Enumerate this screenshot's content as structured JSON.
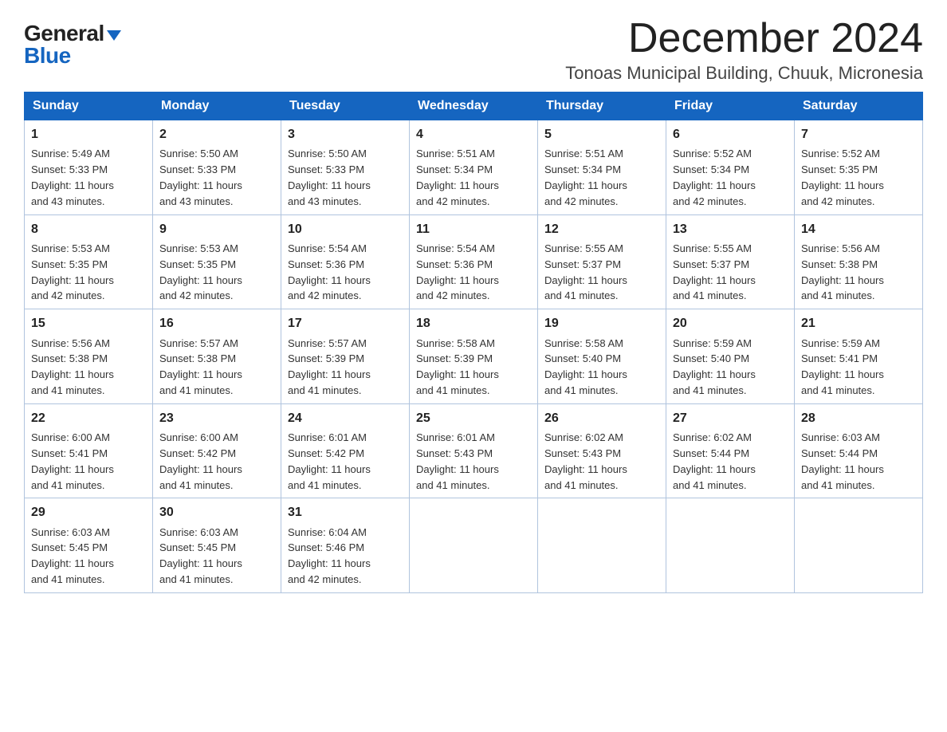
{
  "header": {
    "logo_general": "General",
    "logo_blue": "Blue",
    "month_title": "December 2024",
    "location": "Tonoas Municipal Building, Chuuk, Micronesia"
  },
  "weekdays": [
    "Sunday",
    "Monday",
    "Tuesday",
    "Wednesday",
    "Thursday",
    "Friday",
    "Saturday"
  ],
  "weeks": [
    [
      {
        "day": "1",
        "sunrise": "5:49 AM",
        "sunset": "5:33 PM",
        "daylight": "11 hours and 43 minutes."
      },
      {
        "day": "2",
        "sunrise": "5:50 AM",
        "sunset": "5:33 PM",
        "daylight": "11 hours and 43 minutes."
      },
      {
        "day": "3",
        "sunrise": "5:50 AM",
        "sunset": "5:33 PM",
        "daylight": "11 hours and 43 minutes."
      },
      {
        "day": "4",
        "sunrise": "5:51 AM",
        "sunset": "5:34 PM",
        "daylight": "11 hours and 42 minutes."
      },
      {
        "day": "5",
        "sunrise": "5:51 AM",
        "sunset": "5:34 PM",
        "daylight": "11 hours and 42 minutes."
      },
      {
        "day": "6",
        "sunrise": "5:52 AM",
        "sunset": "5:34 PM",
        "daylight": "11 hours and 42 minutes."
      },
      {
        "day": "7",
        "sunrise": "5:52 AM",
        "sunset": "5:35 PM",
        "daylight": "11 hours and 42 minutes."
      }
    ],
    [
      {
        "day": "8",
        "sunrise": "5:53 AM",
        "sunset": "5:35 PM",
        "daylight": "11 hours and 42 minutes."
      },
      {
        "day": "9",
        "sunrise": "5:53 AM",
        "sunset": "5:35 PM",
        "daylight": "11 hours and 42 minutes."
      },
      {
        "day": "10",
        "sunrise": "5:54 AM",
        "sunset": "5:36 PM",
        "daylight": "11 hours and 42 minutes."
      },
      {
        "day": "11",
        "sunrise": "5:54 AM",
        "sunset": "5:36 PM",
        "daylight": "11 hours and 42 minutes."
      },
      {
        "day": "12",
        "sunrise": "5:55 AM",
        "sunset": "5:37 PM",
        "daylight": "11 hours and 41 minutes."
      },
      {
        "day": "13",
        "sunrise": "5:55 AM",
        "sunset": "5:37 PM",
        "daylight": "11 hours and 41 minutes."
      },
      {
        "day": "14",
        "sunrise": "5:56 AM",
        "sunset": "5:38 PM",
        "daylight": "11 hours and 41 minutes."
      }
    ],
    [
      {
        "day": "15",
        "sunrise": "5:56 AM",
        "sunset": "5:38 PM",
        "daylight": "11 hours and 41 minutes."
      },
      {
        "day": "16",
        "sunrise": "5:57 AM",
        "sunset": "5:38 PM",
        "daylight": "11 hours and 41 minutes."
      },
      {
        "day": "17",
        "sunrise": "5:57 AM",
        "sunset": "5:39 PM",
        "daylight": "11 hours and 41 minutes."
      },
      {
        "day": "18",
        "sunrise": "5:58 AM",
        "sunset": "5:39 PM",
        "daylight": "11 hours and 41 minutes."
      },
      {
        "day": "19",
        "sunrise": "5:58 AM",
        "sunset": "5:40 PM",
        "daylight": "11 hours and 41 minutes."
      },
      {
        "day": "20",
        "sunrise": "5:59 AM",
        "sunset": "5:40 PM",
        "daylight": "11 hours and 41 minutes."
      },
      {
        "day": "21",
        "sunrise": "5:59 AM",
        "sunset": "5:41 PM",
        "daylight": "11 hours and 41 minutes."
      }
    ],
    [
      {
        "day": "22",
        "sunrise": "6:00 AM",
        "sunset": "5:41 PM",
        "daylight": "11 hours and 41 minutes."
      },
      {
        "day": "23",
        "sunrise": "6:00 AM",
        "sunset": "5:42 PM",
        "daylight": "11 hours and 41 minutes."
      },
      {
        "day": "24",
        "sunrise": "6:01 AM",
        "sunset": "5:42 PM",
        "daylight": "11 hours and 41 minutes."
      },
      {
        "day": "25",
        "sunrise": "6:01 AM",
        "sunset": "5:43 PM",
        "daylight": "11 hours and 41 minutes."
      },
      {
        "day": "26",
        "sunrise": "6:02 AM",
        "sunset": "5:43 PM",
        "daylight": "11 hours and 41 minutes."
      },
      {
        "day": "27",
        "sunrise": "6:02 AM",
        "sunset": "5:44 PM",
        "daylight": "11 hours and 41 minutes."
      },
      {
        "day": "28",
        "sunrise": "6:03 AM",
        "sunset": "5:44 PM",
        "daylight": "11 hours and 41 minutes."
      }
    ],
    [
      {
        "day": "29",
        "sunrise": "6:03 AM",
        "sunset": "5:45 PM",
        "daylight": "11 hours and 41 minutes."
      },
      {
        "day": "30",
        "sunrise": "6:03 AM",
        "sunset": "5:45 PM",
        "daylight": "11 hours and 41 minutes."
      },
      {
        "day": "31",
        "sunrise": "6:04 AM",
        "sunset": "5:46 PM",
        "daylight": "11 hours and 42 minutes."
      },
      null,
      null,
      null,
      null
    ]
  ],
  "labels": {
    "sunrise": "Sunrise:",
    "sunset": "Sunset:",
    "daylight": "Daylight:"
  }
}
